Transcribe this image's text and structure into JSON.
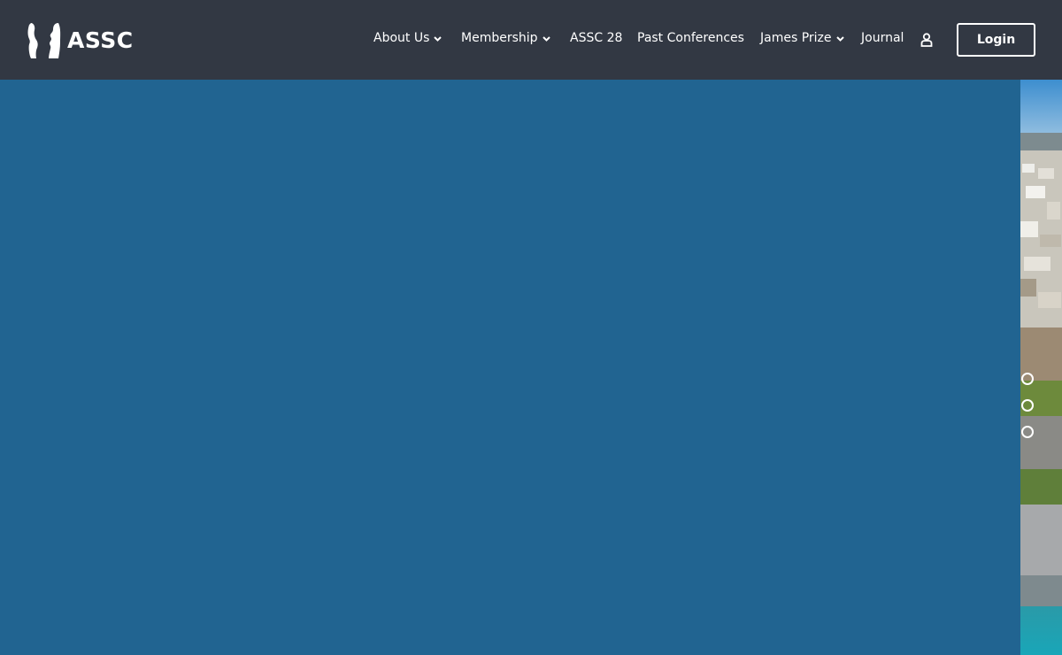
{
  "brand": {
    "name": "ASSC"
  },
  "nav": {
    "items": [
      {
        "label": "About Us",
        "has_dropdown": true
      },
      {
        "label": "Membership",
        "has_dropdown": true
      },
      {
        "label": "ASSC 28",
        "has_dropdown": false
      },
      {
        "label": "Past Conferences",
        "has_dropdown": false
      },
      {
        "label": "James Prize",
        "has_dropdown": true
      },
      {
        "label": "Journal",
        "has_dropdown": false
      }
    ],
    "user_icon": "user-icon",
    "login_label": "Login"
  },
  "slider": {
    "dot_count": 3
  },
  "colors": {
    "navbar_bg": "#323843",
    "hero_bg": "#216491",
    "text": "#ffffff"
  }
}
